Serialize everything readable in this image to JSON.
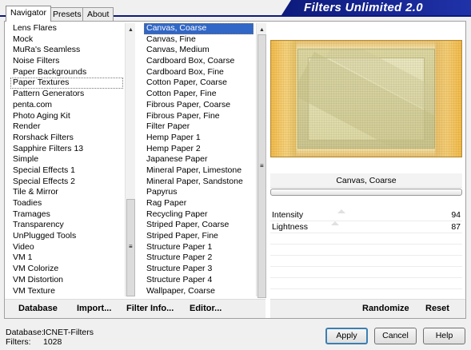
{
  "window": {
    "title": "Filters Unlimited 2.0",
    "colors": {
      "banner": "#0d1a7c",
      "selection": "#3167c6"
    }
  },
  "tabs": [
    {
      "label": "Navigator",
      "active": true
    },
    {
      "label": "Presets",
      "active": false
    },
    {
      "label": "About",
      "active": false
    }
  ],
  "categories": {
    "items": [
      "Lens Flares",
      "Mock",
      "MuRa's Seamless",
      "Noise Filters",
      "Paper Backgrounds",
      "Paper Textures",
      "Pattern Generators",
      "penta.com",
      "Photo Aging Kit",
      "Render",
      "Rorshack Filters",
      "Sapphire Filters 13",
      "Simple",
      "Special Effects 1",
      "Special Effects 2",
      "Tile & Mirror",
      "Toadies",
      "Tramages",
      "Transparency",
      "UnPlugged Tools",
      "Video",
      "VM 1",
      "VM Colorize",
      "VM Distortion",
      "VM Texture"
    ],
    "cursor_item": "Paper Textures"
  },
  "filters": {
    "items": [
      "Canvas, Coarse",
      "Canvas, Fine",
      "Canvas, Medium",
      "Cardboard Box, Coarse",
      "Cardboard Box, Fine",
      "Cotton Paper, Coarse",
      "Cotton Paper, Fine",
      "Fibrous Paper, Coarse",
      "Fibrous Paper, Fine",
      "Filter Paper",
      "Hemp Paper 1",
      "Hemp Paper 2",
      "Japanese Paper",
      "Mineral Paper, Limestone",
      "Mineral Paper, Sandstone",
      "Papyrus",
      "Rag Paper",
      "Recycling Paper",
      "Striped Paper, Coarse",
      "Striped Paper, Fine",
      "Structure Paper 1",
      "Structure Paper 2",
      "Structure Paper 3",
      "Structure Paper 4",
      "Wallpaper, Coarse"
    ],
    "selected_item": "Canvas, Coarse"
  },
  "preview": {
    "filter_name": "Canvas, Coarse"
  },
  "parameters": [
    {
      "label": "Intensity",
      "value": "94"
    },
    {
      "label": "Lightness",
      "value": "87"
    }
  ],
  "toolbar": {
    "database_label": "Database",
    "import_label": "Import...",
    "filter_info_label": "Filter Info...",
    "editor_label": "Editor...",
    "randomize_label": "Randomize",
    "reset_label": "Reset"
  },
  "status": {
    "database_key": "Database:",
    "database_value": "ICNET-Filters",
    "filters_key": "Filters:",
    "filters_value": "1028"
  },
  "dialog": {
    "apply_label": "Apply",
    "cancel_label": "Cancel",
    "help_label": "Help"
  }
}
